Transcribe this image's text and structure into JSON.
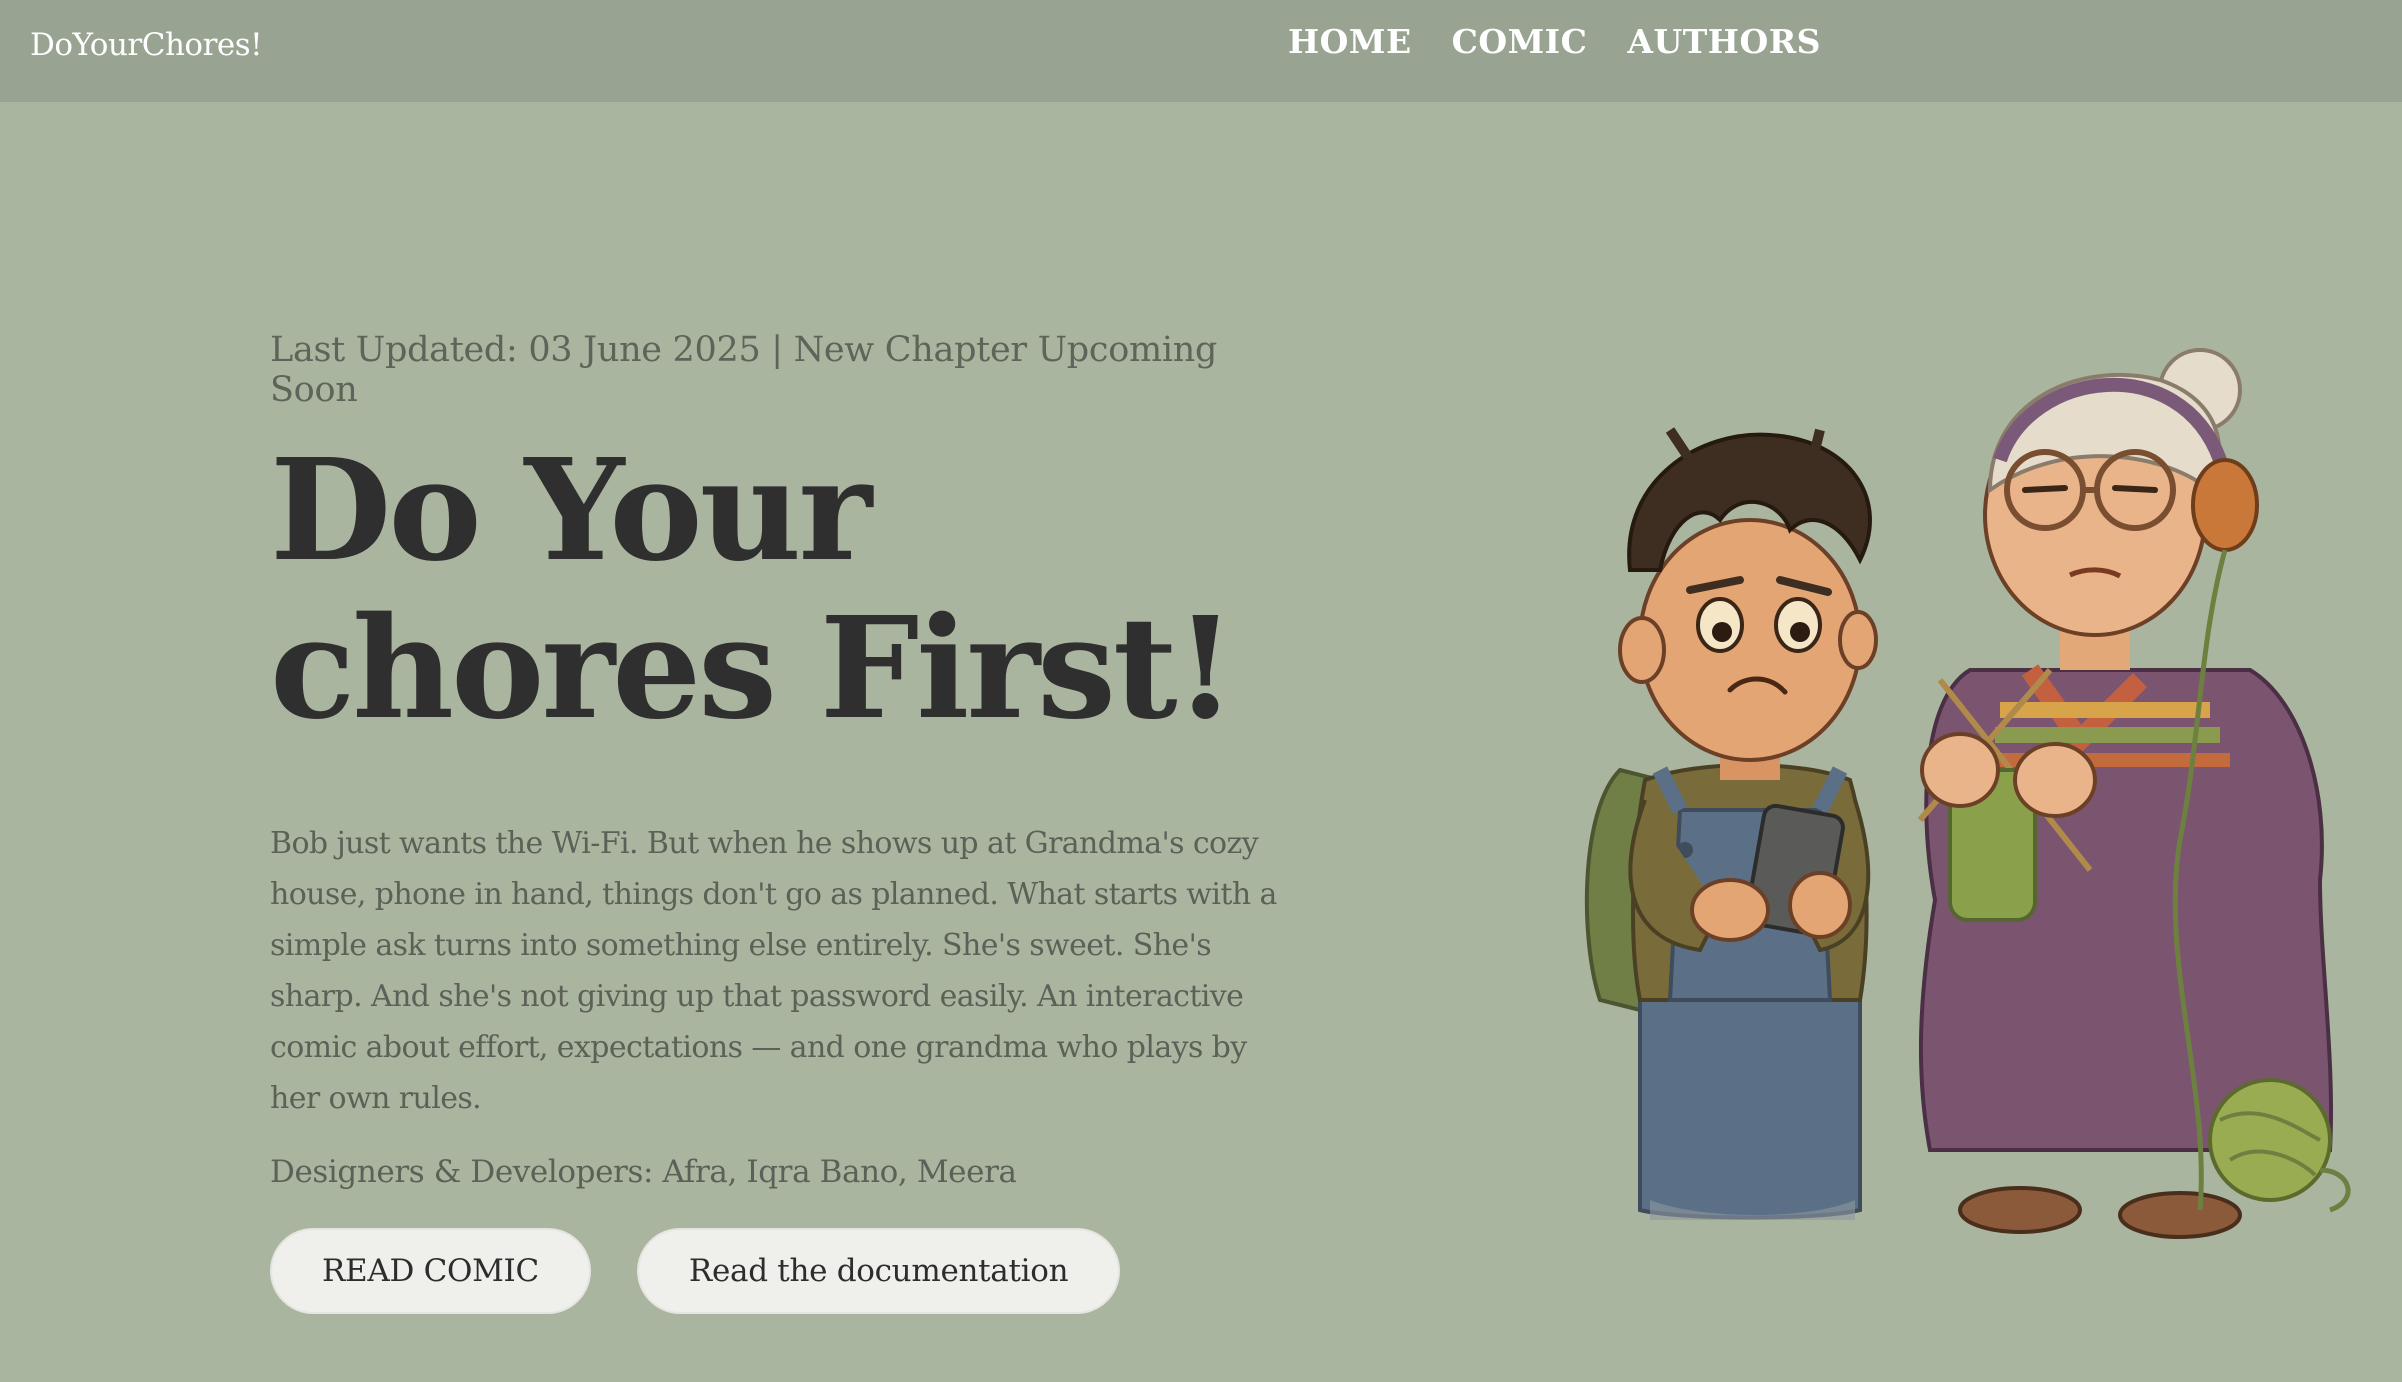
{
  "header": {
    "brand": "DoYourChores!",
    "nav": [
      {
        "label": "HOME"
      },
      {
        "label": "COMIC"
      },
      {
        "label": "AUTHORS"
      }
    ]
  },
  "hero": {
    "meta": "Last Updated: 03 June 2025 | New Chapter Upcoming Soon",
    "title_line1": "Do Your",
    "title_line2": "chores First!",
    "description": "Bob just wants the Wi-Fi. But when he shows up at Grandma's cozy house, phone in hand, things don't go as planned. What starts with a simple ask turns into something else entirely. She's sweet. She's sharp. And she's not giving up that password easily. An interactive comic about effort, expectations — and one grandma who plays by her own rules.",
    "credits": "Designers & Developers: Afra, Iqra Bano, Meera",
    "buttons": {
      "read_comic": "READ COMIC",
      "documentation": "Read the documentation"
    }
  },
  "colors": {
    "background": "#aab5a0",
    "header_bg": "#98a392",
    "title_text": "#2f2f2f",
    "body_text": "#5c6158",
    "button_bg": "#efefec"
  }
}
